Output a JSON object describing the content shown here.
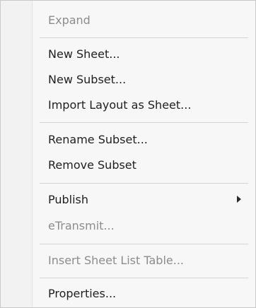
{
  "context_menu": {
    "items": [
      {
        "label": "Expand",
        "enabled": false
      },
      {
        "label": "New Sheet...",
        "enabled": true
      },
      {
        "label": "New Subset...",
        "enabled": true
      },
      {
        "label": "Import Layout as Sheet...",
        "enabled": true
      },
      {
        "label": "Rename Subset...",
        "enabled": true
      },
      {
        "label": "Remove Subset",
        "enabled": true
      },
      {
        "label": "Publish",
        "enabled": true,
        "submenu_icon": "chevron-right-icon"
      },
      {
        "label": "eTransmit...",
        "enabled": false
      },
      {
        "label": "Insert Sheet List Table...",
        "enabled": false
      },
      {
        "label": "Properties...",
        "enabled": true
      }
    ]
  }
}
